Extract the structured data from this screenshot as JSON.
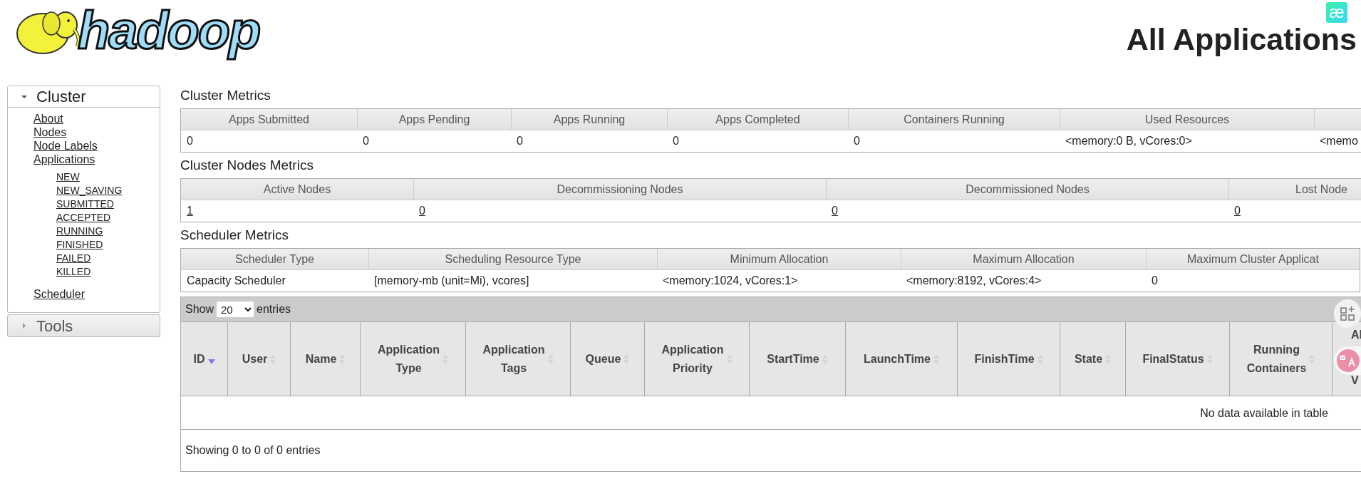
{
  "header": {
    "logo_text": "hadoop",
    "title": "All Applications",
    "extension_badge": "æ"
  },
  "sidebar": [
    {
      "label": "Cluster",
      "expanded": true,
      "children": [
        {
          "label": "About"
        },
        {
          "label": "Nodes"
        },
        {
          "label": "Node Labels"
        },
        {
          "label": "Applications",
          "children": [
            {
              "label": "NEW"
            },
            {
              "label": "NEW_SAVING"
            },
            {
              "label": "SUBMITTED"
            },
            {
              "label": "ACCEPTED"
            },
            {
              "label": "RUNNING"
            },
            {
              "label": "FINISHED"
            },
            {
              "label": "FAILED"
            },
            {
              "label": "KILLED"
            }
          ]
        },
        {
          "label": "Scheduler",
          "spaced": true
        }
      ]
    },
    {
      "label": "Tools",
      "expanded": false
    }
  ],
  "metrics": [
    {
      "title": "Cluster Metrics",
      "columns": [
        {
          "label": "Apps Submitted",
          "value": "0",
          "link": false
        },
        {
          "label": "Apps Pending",
          "value": "0",
          "link": false
        },
        {
          "label": "Apps Running",
          "value": "0",
          "link": false
        },
        {
          "label": "Apps Completed",
          "value": "0",
          "link": false
        },
        {
          "label": "Containers Running",
          "value": "0",
          "link": false
        },
        {
          "label": "Used Resources",
          "value": "<memory:0 B, vCores:0>",
          "link": false
        },
        {
          "value": "<memo",
          "link": false
        }
      ]
    },
    {
      "title": "Cluster Nodes Metrics",
      "columns": [
        {
          "label": "Active Nodes",
          "value": "1",
          "link": true
        },
        {
          "label": "Decommissioning Nodes",
          "value": "0",
          "link": true
        },
        {
          "label": "Decommissioned Nodes",
          "value": "0",
          "link": true
        },
        {
          "label": "Lost Node",
          "value": "0",
          "link": true
        }
      ]
    },
    {
      "title": "Scheduler Metrics",
      "columns": [
        {
          "label": "Scheduler Type",
          "value": "Capacity Scheduler",
          "link": false
        },
        {
          "label": "Scheduling Resource Type",
          "value": "[memory-mb (unit=Mi), vcores]",
          "link": false
        },
        {
          "label": "Minimum Allocation",
          "value": "<memory:1024, vCores:1>",
          "link": false
        },
        {
          "label": "Maximum Allocation",
          "value": "<memory:8192, vCores:4>",
          "link": false
        },
        {
          "label": "Maximum Cluster Applicat",
          "value": "0",
          "link": false
        }
      ]
    }
  ],
  "apps_table": {
    "show_label": "Show",
    "page_size": "20",
    "entries_label": "entries",
    "columns": [
      {
        "lines": [
          "ID"
        ],
        "sorted": true
      },
      {
        "lines": [
          "User"
        ],
        "sorted": false
      },
      {
        "lines": [
          "Name"
        ],
        "sorted": false
      },
      {
        "lines": [
          "Application",
          "Type"
        ],
        "sorted": false
      },
      {
        "lines": [
          "Application",
          "Tags"
        ],
        "sorted": false
      },
      {
        "lines": [
          "Queue"
        ],
        "sorted": false
      },
      {
        "lines": [
          "Application",
          "Priority"
        ],
        "sorted": false
      },
      {
        "lines": [
          "StartTime"
        ],
        "sorted": false
      },
      {
        "lines": [
          "LaunchTime"
        ],
        "sorted": false
      },
      {
        "lines": [
          "FinishTime"
        ],
        "sorted": false
      },
      {
        "lines": [
          "State"
        ],
        "sorted": false
      },
      {
        "lines": [
          "FinalStatus"
        ],
        "sorted": false
      },
      {
        "lines": [
          "Running",
          "Containers"
        ],
        "sorted": false
      },
      {
        "lines": [
          "Al",
          "V"
        ],
        "kind": "partial"
      }
    ],
    "empty_message": "No data available in table",
    "info": "Showing 0 to 0 of 0 entries"
  }
}
